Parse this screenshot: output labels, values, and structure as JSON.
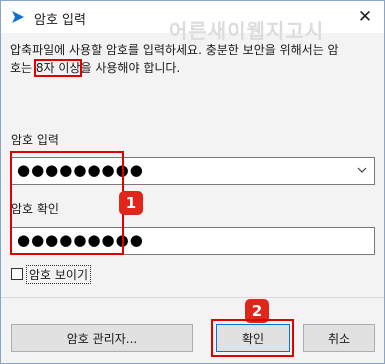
{
  "window": {
    "title": "암호 입력",
    "watermark": "어른새이웹지고시",
    "close_symbol": "✕"
  },
  "description": {
    "line1": "압축파일에 사용할 암호를 입력하세요. 충분한 보안을 위해서는 암",
    "line2_prefix": "호는 ",
    "line2_highlight": "8자 이상",
    "line2_suffix": "을 사용해야 합니다."
  },
  "password": {
    "label": "암호 입력",
    "masked_value": "●●●●●●●●●"
  },
  "confirm": {
    "label": "암호 확인",
    "masked_value": "●●●●●●●●●"
  },
  "show_password": {
    "label": "암호 보이기",
    "checked": false
  },
  "markers": {
    "step1": "1",
    "step2": "2"
  },
  "buttons": {
    "manager": "암호 관리자...",
    "ok": "확인",
    "cancel": "취소"
  },
  "colors": {
    "highlight": "#e00000",
    "marker_bg": "#e0261b",
    "icon_blue": "#0f6fd0"
  },
  "icons": {
    "app": "bandizip-arrow-icon",
    "dropdown": "chevron-down-icon",
    "close": "close-icon"
  }
}
